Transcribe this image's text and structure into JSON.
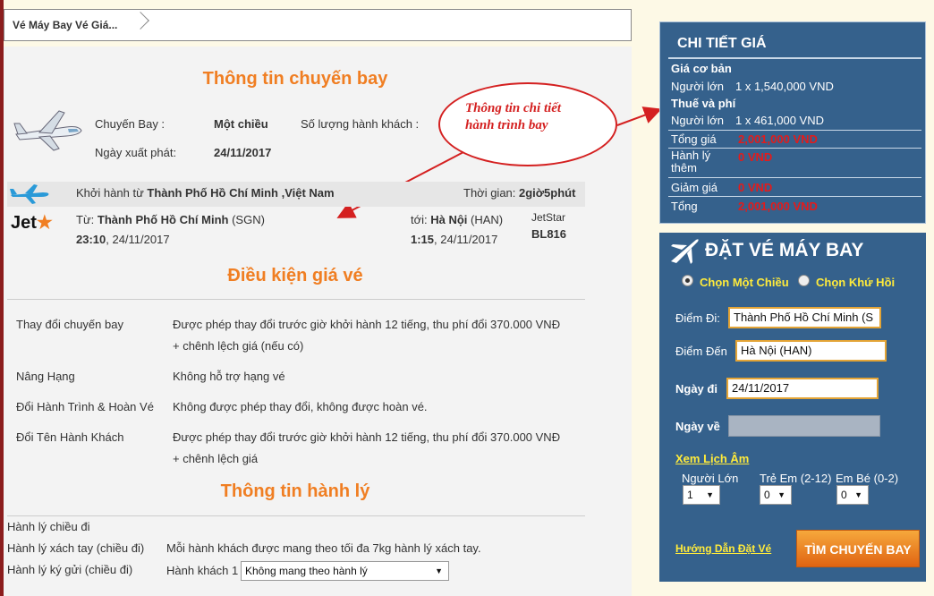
{
  "breadcrumb": {
    "tab": "Vé Máy Bay Vé Giá..."
  },
  "flight_info": {
    "title": "Thông tin chuyến bay",
    "flight_label": "Chuyến Bay :",
    "flight_value": "Một chiều",
    "passengers_label": "Số lượng hành khách :",
    "date_label": "Ngày xuất phát:",
    "date_value": "24/11/2017"
  },
  "annotation": {
    "line1": "Thông tin chi tiết",
    "line2": "hành trình bay"
  },
  "itinerary": {
    "depart_prefix": "Khởi hành từ ",
    "depart_city": "Thành Phố Hồ Chí Minh ,Việt Nam",
    "duration_label": "Thời gian: ",
    "duration_value": "2giờ5phút",
    "airline_logo": "Jet",
    "from_label": "Từ: ",
    "from_city": "Thành Phố Hồ Chí Minh",
    "from_code": " (SGN)",
    "dep_time": "23:10",
    "dep_date": ", 24/11/2017",
    "to_label": "tới: ",
    "to_city": "Hà Nội",
    "to_code": " (HAN)",
    "arr_time": "1:15",
    "arr_date": ", 24/11/2017",
    "carrier": "JetStar",
    "flight_no": "BL816"
  },
  "fare_conditions": {
    "title": "Điều kiện giá vé",
    "rows": [
      {
        "label": "Thay đổi chuyến bay",
        "line1": "Được phép thay đổi trước giờ khởi hành 12 tiếng, thu phí đổi 370.000 VNĐ",
        "line2": "+ chênh lệch giá  (nếu có)"
      },
      {
        "label": "Nâng Hạng",
        "line1": "Không hỗ trợ hạng vé"
      },
      {
        "label": "Đổi Hành Trình & Hoàn Vé",
        "line1": "Không được phép thay đổi, không được hoàn vé."
      },
      {
        "label": "Đổi Tên Hành Khách",
        "line1": "Được phép thay đổi trước giờ khởi hành 12 tiếng, thu phí đổi 370.000 VNĐ",
        "line2": "+ chênh lệch giá"
      }
    ]
  },
  "baggage": {
    "title": "Thông tin hành lý",
    "outbound": "Hành lý chiều đi",
    "carry_on_label": "Hành lý xách tay (chiều đi)",
    "carry_on_value": "Mỗi hành khách được mang theo tối đa 7kg hành lý xách tay.",
    "checked_label": "Hành lý ký gửi (chiều đi)",
    "passenger_label": "Hành khách 1",
    "checked_select": "Không mang theo hành lý"
  },
  "price_detail": {
    "title": "CHI TIẾT GIÁ",
    "base_label": "Giá cơ bản",
    "adult1_label": "Người lớn",
    "adult1_value": "1 x 1,540,000 VND",
    "tax_label": "Thuế và phí",
    "adult2_label": "Người lớn",
    "adult2_value": "1 x 461,000 VND",
    "total_label": "Tổng giá",
    "total_value": "2,001,000 VND",
    "baggage_label1": "Hành lý",
    "baggage_label2": "thêm",
    "baggage_value": "0 VND",
    "discount_label": "Giảm giá",
    "discount_value": "0 VND",
    "grand_label": "Tổng",
    "grand_value": "2,001,000 VND"
  },
  "booking": {
    "title": "ĐẶT VÉ MÁY BAY",
    "one_way": "Chọn Một Chiều",
    "round_trip": "Chọn Khứ Hồi",
    "from_label": "Điểm Đi:",
    "from_value": "Thành Phố Hồ Chí Minh (S",
    "to_label": "Điểm Đến",
    "to_value": "Hà Nội (HAN)",
    "depart_label": "Ngày đi",
    "depart_value": "24/11/2017",
    "return_label": "Ngày về",
    "lunar_link": "Xem Lịch Âm",
    "adult_label": "Người Lớn",
    "adult_value": "1",
    "child_label": "Trẻ Em (2-12)",
    "child_value": "0",
    "infant_label": "Em Bé (0-2)",
    "infant_value": "0",
    "guide_link": "Hướng Dẫn Đặt Vé",
    "search_button": "TÌM CHUYẾN BAY"
  },
  "colors": {
    "accent": "#f07e22",
    "panel": "#35618c",
    "price_red": "#e31b1b",
    "link_yellow": "#ffeb3b"
  }
}
